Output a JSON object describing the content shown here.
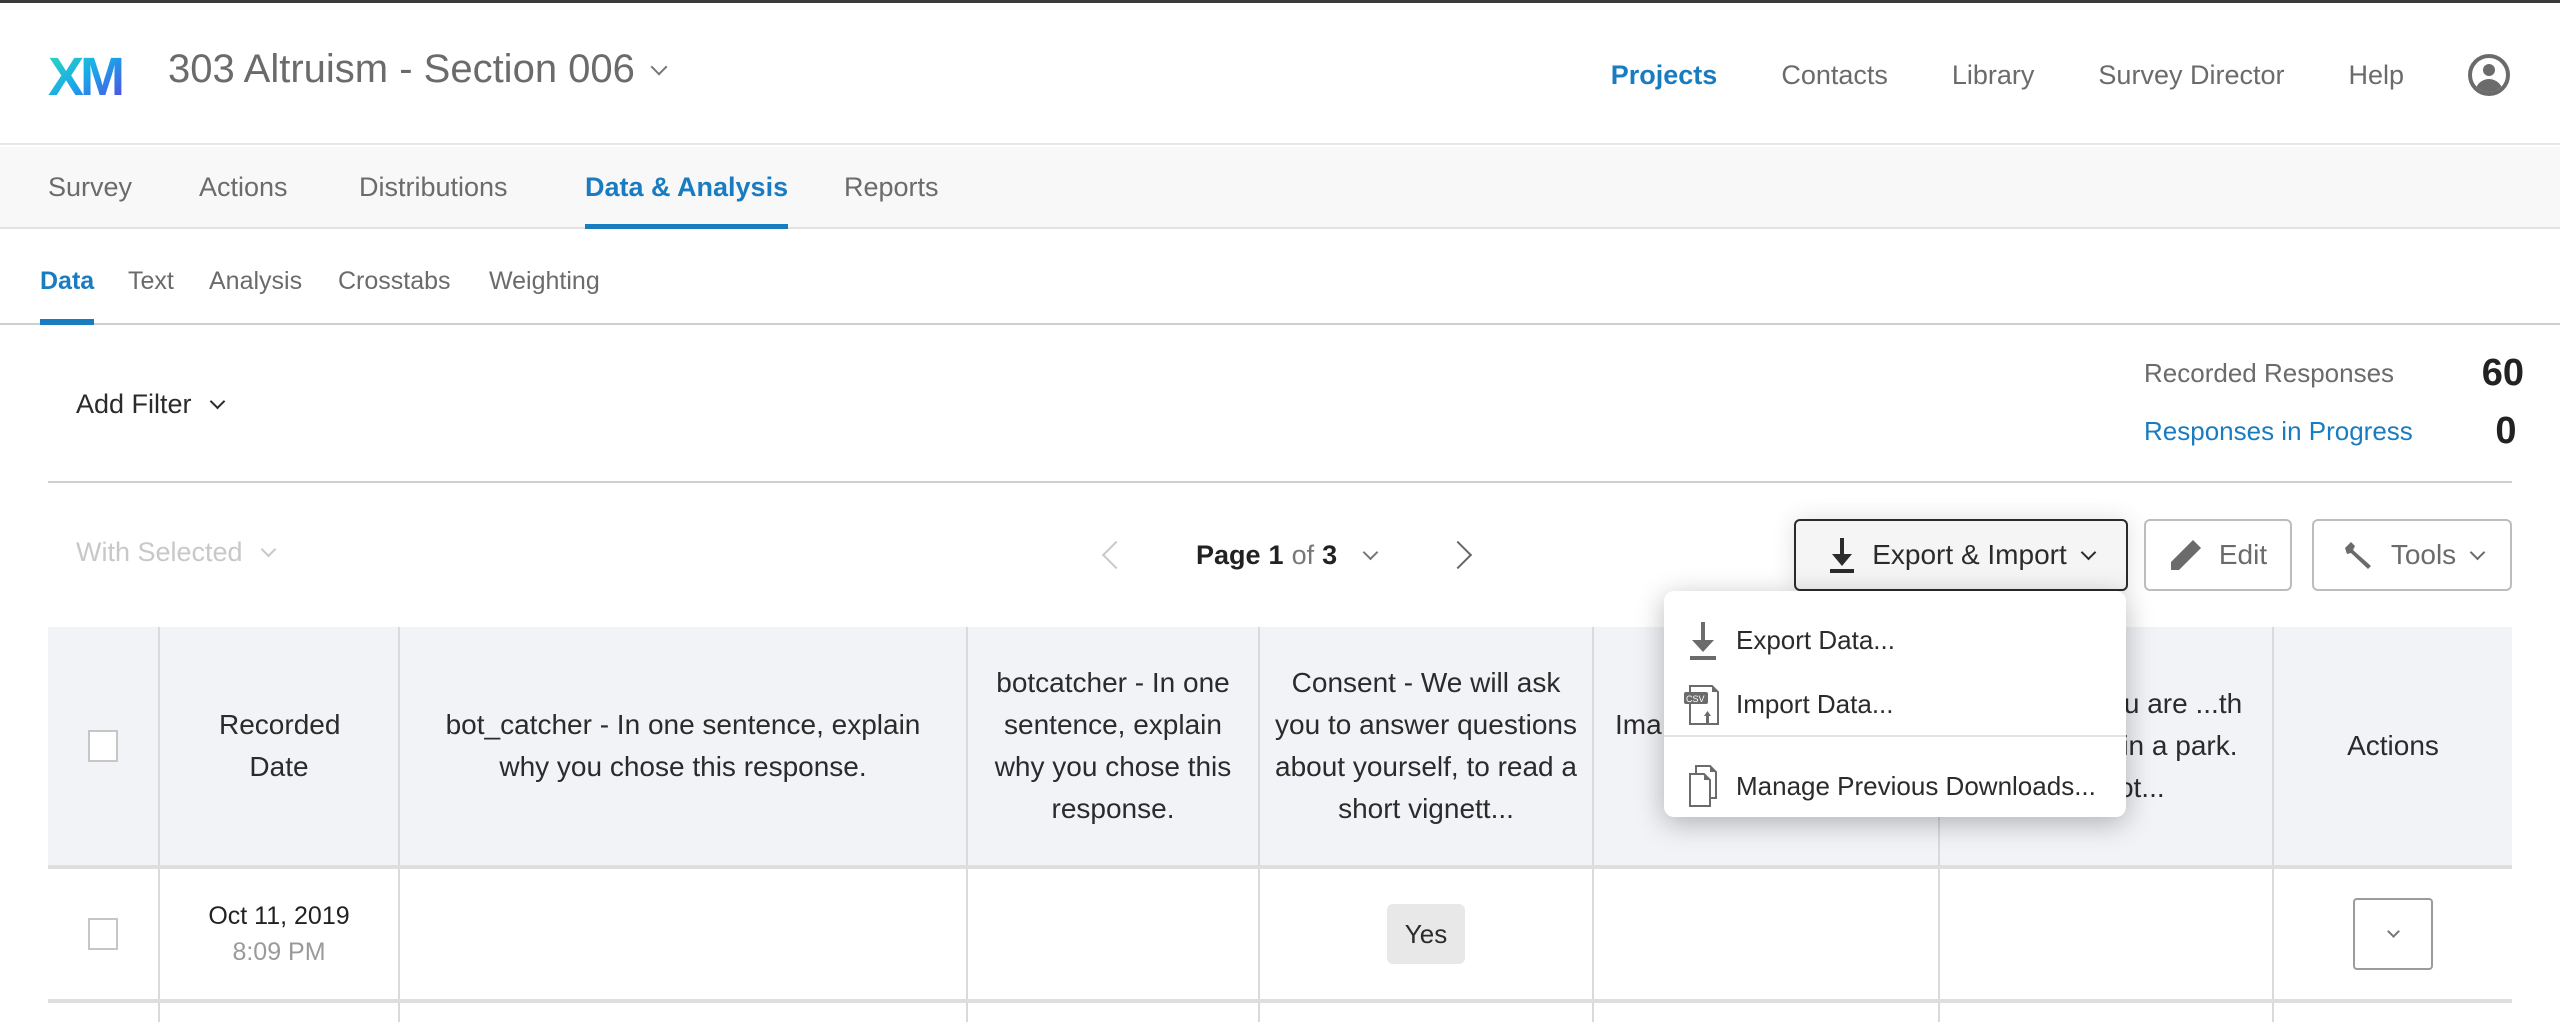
{
  "app": {
    "logo_text": "XM",
    "project_title": "303 Altruism - Section 006"
  },
  "topnav": {
    "items": [
      {
        "label": "Projects",
        "active": true
      },
      {
        "label": "Contacts",
        "active": false
      },
      {
        "label": "Library",
        "active": false
      },
      {
        "label": "Survey Director",
        "active": false
      },
      {
        "label": "Help",
        "active": false
      }
    ],
    "account_icon": "user-circle-icon"
  },
  "tabs": {
    "items": [
      {
        "label": "Survey"
      },
      {
        "label": "Actions"
      },
      {
        "label": "Distributions"
      },
      {
        "label": "Data & Analysis",
        "active": true
      },
      {
        "label": "Reports"
      }
    ]
  },
  "subtabs": {
    "items": [
      {
        "label": "Data",
        "active": true
      },
      {
        "label": "Text"
      },
      {
        "label": "Analysis"
      },
      {
        "label": "Crosstabs"
      },
      {
        "label": "Weighting"
      }
    ]
  },
  "filter": {
    "add_filter_label": "Add Filter"
  },
  "stats": {
    "recorded_label": "Recorded Responses",
    "recorded_value": "60",
    "in_progress_label": "Responses in Progress",
    "in_progress_value": "0"
  },
  "toolbar": {
    "with_selected_label": "With Selected",
    "page_word": "Page",
    "current_page": "1",
    "of_word": "of",
    "total_pages": "3",
    "export_import_label": "Export & Import",
    "edit_label": "Edit",
    "tools_label": "Tools"
  },
  "export_menu": {
    "items": [
      {
        "label": "Export Data...",
        "icon": "download-icon"
      },
      {
        "label": "Import Data...",
        "icon": "csv-upload-icon"
      },
      {
        "label": "Manage Previous Downloads...",
        "icon": "documents-icon"
      }
    ]
  },
  "table": {
    "columns": [
      {
        "label": ""
      },
      {
        "label": "Recorded Date"
      },
      {
        "label": "bot_catcher - In one sentence, explain why you chose this response."
      },
      {
        "label": "botcatcher - In one sentence, explain why you chose this response."
      },
      {
        "label": "Consent - We will ask you to answer questions about yourself, to read a short vignett..."
      },
      {
        "label": "Ima... ch... o... park. You not..."
      },
      {
        "label": "...Imagine ...u are ...th three ...nds in a park. You not..."
      },
      {
        "label": "Actions"
      }
    ],
    "rows": [
      {
        "date": "Oct 11, 2019",
        "time": "8:09 PM",
        "bot_catcher": "",
        "botcatcher": "",
        "consent": "Yes",
        "col5": "",
        "col6": ""
      }
    ]
  },
  "colors": {
    "accent": "#1a7cc0",
    "text": "#2b2b2b",
    "muted": "#6b6b6b",
    "header_bg": "#f2f3f7"
  }
}
